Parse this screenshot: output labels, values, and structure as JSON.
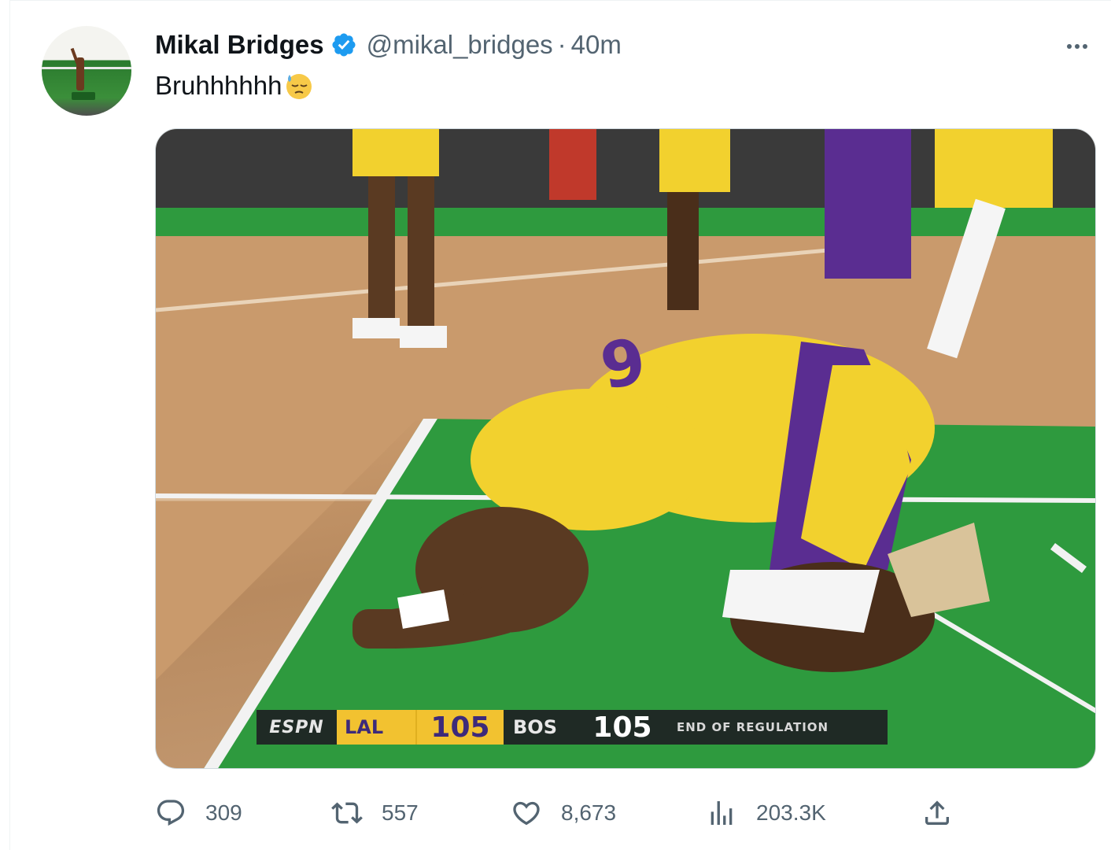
{
  "tweet": {
    "author": {
      "display_name": "Mikal Bridges",
      "handle": "@mikal_bridges",
      "verified": true,
      "avatar_icon": "avatar-photo"
    },
    "separator": "·",
    "time": "40m",
    "text": "Bruhhhhhh",
    "emoji": "downcast-face-with-sweat-emoji"
  },
  "media": {
    "scorebug": {
      "network": "ESPN",
      "team1": "LAL",
      "score1": "105",
      "team2": "BOS",
      "score2": "105",
      "status": "END OF REGULATION"
    },
    "colors": {
      "court_green": "#2e9a3e",
      "lakers_gold": "#f2d12e",
      "lakers_purple": "#5a2d91"
    }
  },
  "actions": {
    "reply": {
      "icon": "reply-icon",
      "count": "309"
    },
    "retweet": {
      "icon": "retweet-icon",
      "count": "557"
    },
    "like": {
      "icon": "heart-icon",
      "count": "8,673"
    },
    "views": {
      "icon": "views-icon",
      "count": "203.3K"
    },
    "share": {
      "icon": "share-icon"
    }
  }
}
